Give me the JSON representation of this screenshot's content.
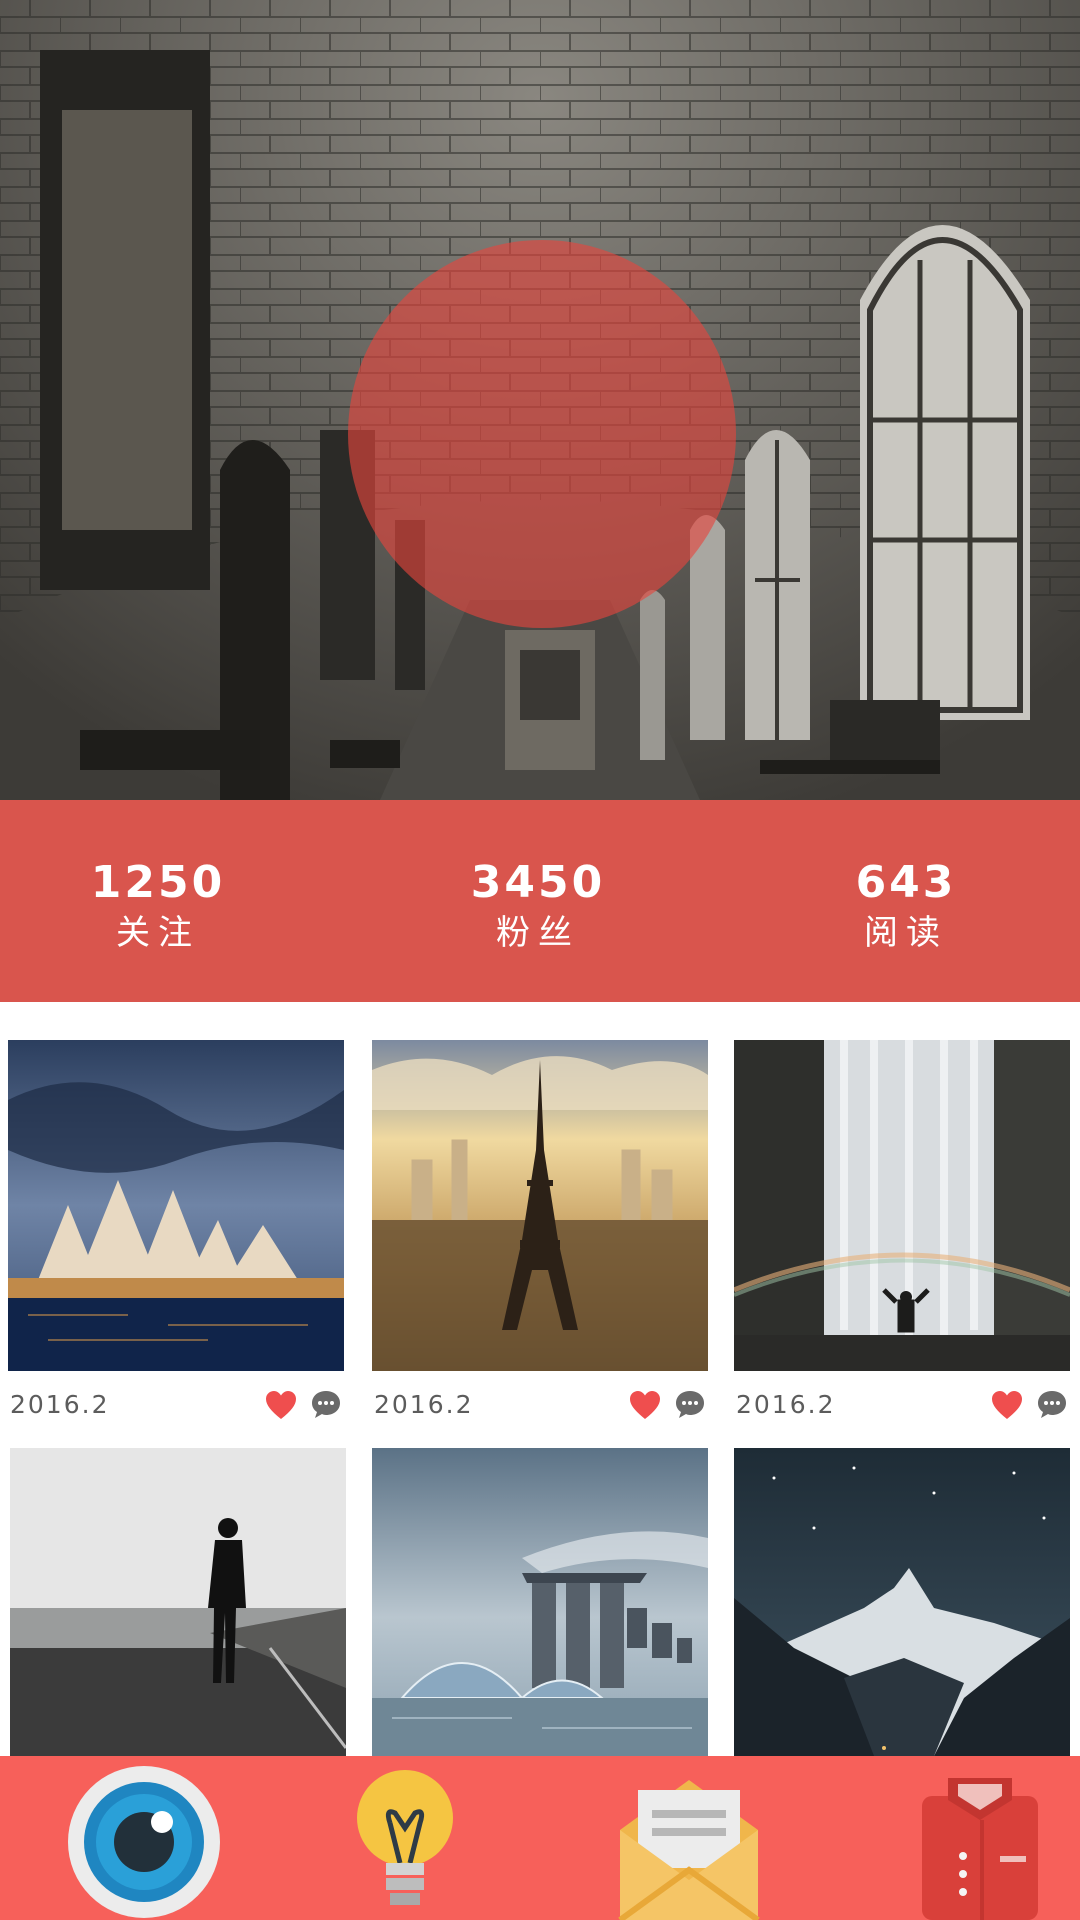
{
  "profile_stats": [
    {
      "value": "1250",
      "label": "关注"
    },
    {
      "value": "3450",
      "label": "粉丝"
    },
    {
      "value": "643",
      "label": "阅读"
    }
  ],
  "posts": [
    {
      "subject": "sydney-opera-house",
      "date": "2016.2"
    },
    {
      "subject": "eiffel-tower",
      "date": "2016.2"
    },
    {
      "subject": "waterfall-rainbow",
      "date": "2016.2"
    },
    {
      "subject": "person-by-sea",
      "date": ""
    },
    {
      "subject": "marina-bay-sands",
      "date": ""
    },
    {
      "subject": "snowy-mountain-night",
      "date": ""
    }
  ],
  "icons": {
    "like": "heart-icon",
    "comment": "comment-bubble-icon",
    "nav": [
      "eye-icon",
      "lightbulb-icon",
      "envelope-icon",
      "shirt-icon"
    ]
  },
  "colors": {
    "accent": "#f7605a",
    "stats_overlay": "#ee544c",
    "heart": "#ef4e4e",
    "comment": "#6a6a6a"
  }
}
